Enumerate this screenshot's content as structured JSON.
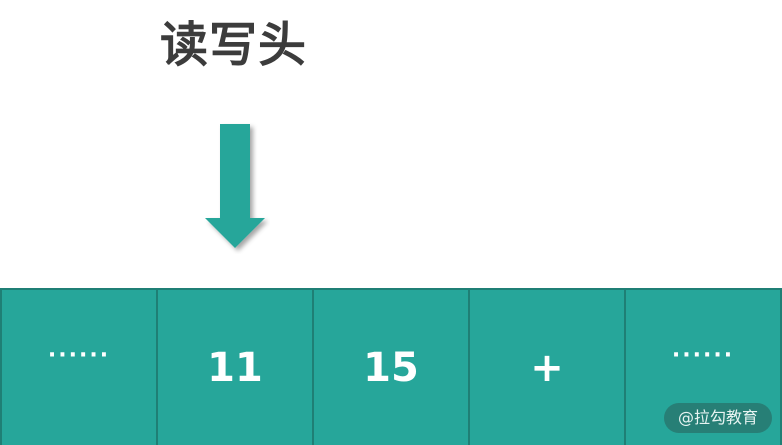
{
  "diagram": {
    "head_label": "读写头",
    "cells": [
      "······",
      "11",
      "15",
      "+",
      "······"
    ],
    "watermark": "@拉勾教育",
    "colors": {
      "cell_fill": "#26a69a",
      "cell_border": "#1f7f75",
      "arrow": "#26a69a",
      "label_text": "#3c3c3c"
    }
  }
}
